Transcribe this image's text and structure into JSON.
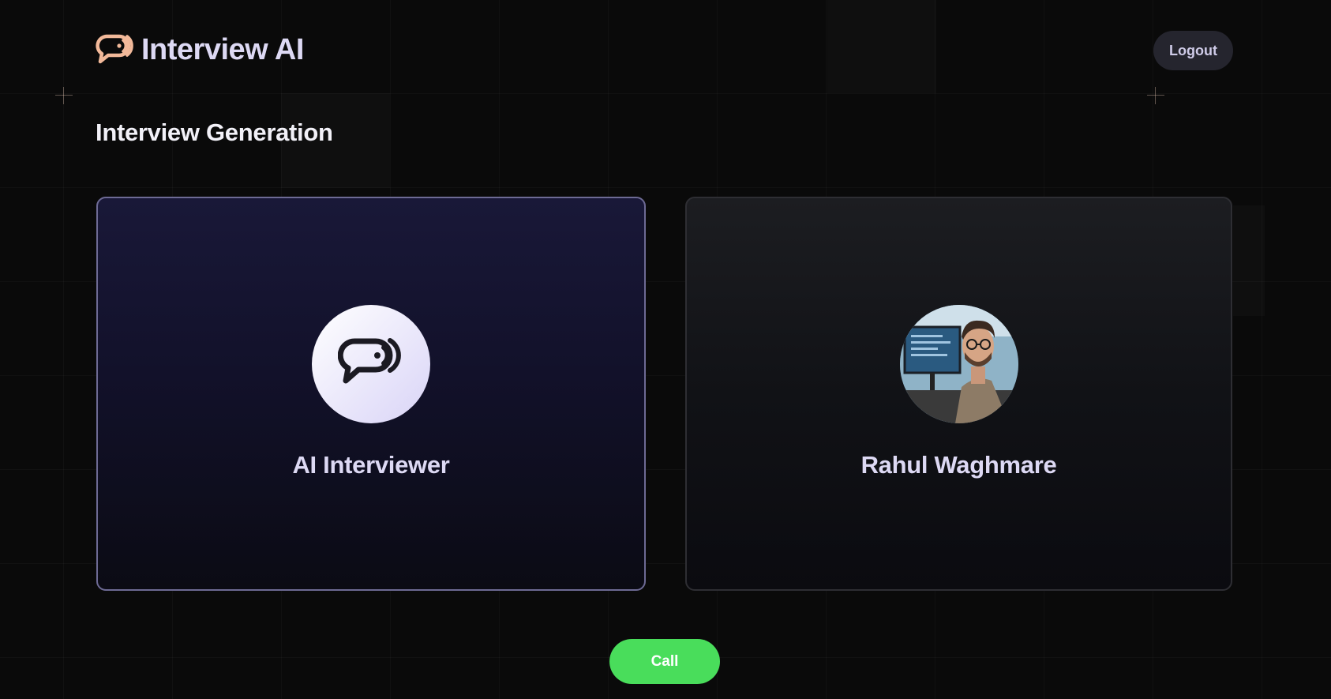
{
  "header": {
    "app_title": "Interview AI",
    "logout_label": "Logout"
  },
  "page_title": "Interview Generation",
  "cards": {
    "ai": {
      "name": "AI Interviewer",
      "icon": "chat-bubble-voice-icon"
    },
    "user": {
      "name": "Rahul Waghmare",
      "avatar": "user-photo"
    }
  },
  "actions": {
    "call_label": "Call"
  },
  "colors": {
    "background": "#0a0a0a",
    "accent_logo": "#f2b99a",
    "call_button": "#49dd5b",
    "ai_card_border": "#6d6a94"
  }
}
